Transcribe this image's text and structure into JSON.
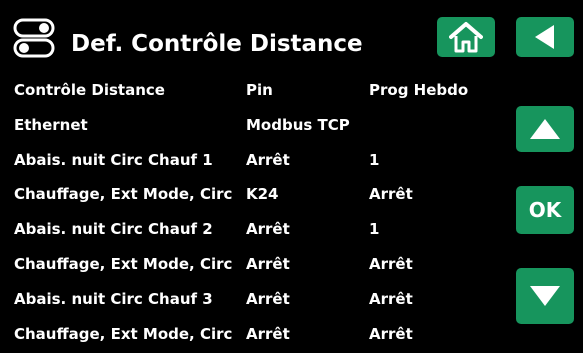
{
  "header": {
    "title": "Def. Contrôle Distance",
    "icon": "remote-control-toggle-icon"
  },
  "buttons": {
    "home_icon": "home-icon",
    "back_icon": "back-arrow-icon",
    "up_icon": "up-arrow-icon",
    "ok_label": "OK",
    "down_icon": "down-arrow-icon"
  },
  "colors": {
    "background": "#000000",
    "button": "#17955d",
    "text": "#ffffff"
  },
  "table": {
    "rows": [
      [
        "Contrôle Distance",
        "Pin",
        "Prog Hebdo"
      ],
      [
        "Ethernet",
        "Modbus TCP",
        ""
      ],
      [
        "Abais. nuit Circ Chauf 1",
        "Arrêt",
        "1"
      ],
      [
        "Chauffage, Ext Mode, Circ",
        "K24",
        "Arrêt"
      ],
      [
        "Abais. nuit Circ Chauf 2",
        "Arrêt",
        "1"
      ],
      [
        "Chauffage, Ext Mode, Circ",
        "Arrêt",
        "Arrêt"
      ],
      [
        "Abais. nuit Circ Chauf 3",
        "Arrêt",
        "Arrêt"
      ],
      [
        "Chauffage, Ext Mode, Circ",
        "Arrêt",
        "Arrêt"
      ]
    ]
  }
}
